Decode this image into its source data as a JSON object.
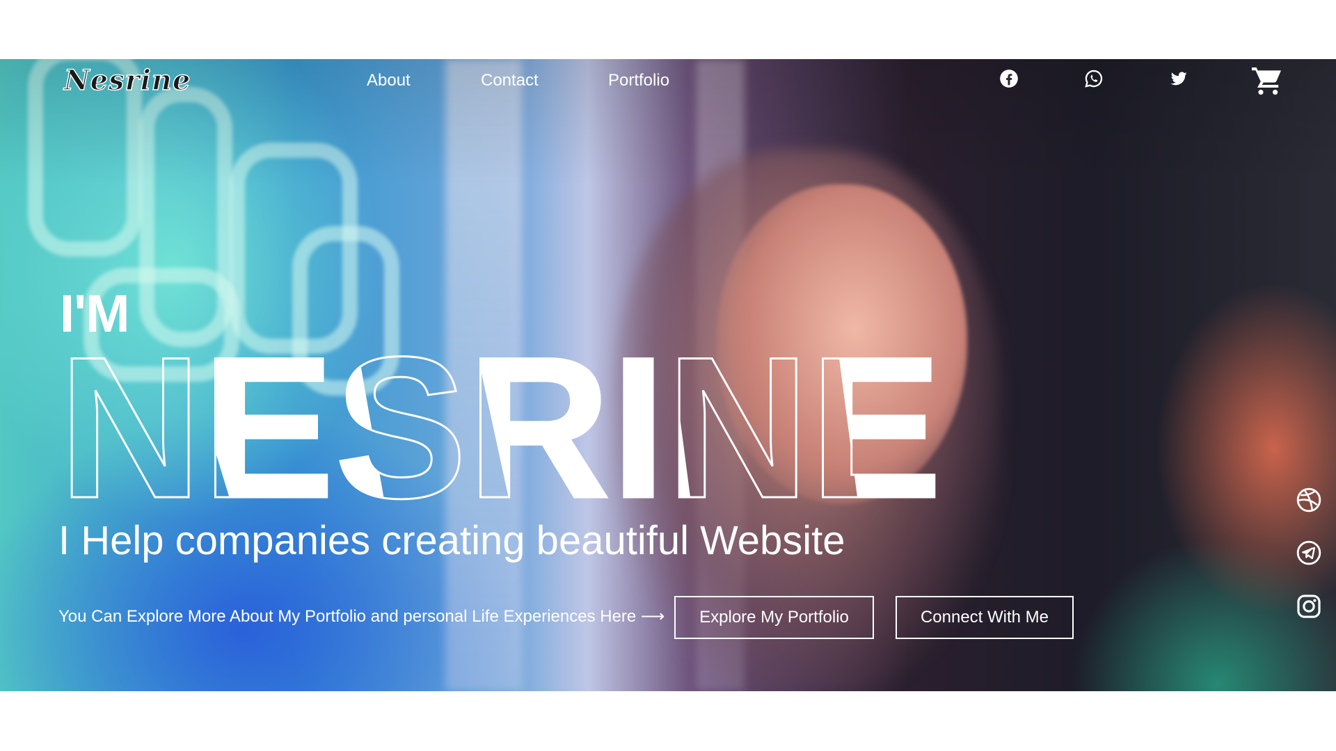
{
  "brand": {
    "logo_text": "Nesrine"
  },
  "nav": {
    "items": [
      {
        "label": "About"
      },
      {
        "label": "Contact"
      },
      {
        "label": "Portfolio"
      }
    ]
  },
  "social_top": [
    {
      "icon": "facebook-icon"
    },
    {
      "icon": "whatsapp-icon"
    },
    {
      "icon": "twitter-icon"
    },
    {
      "icon": "shopping-cart-icon"
    }
  ],
  "hero": {
    "intro": "I'M",
    "name": "NESRINE",
    "tagline": "I Help companies creating beautiful Website",
    "subline": "You Can Explore More About My Portfolio and personal Life Experiences Here ⟶",
    "buttons": {
      "explore": "Explore My Portfolio",
      "connect": "Connect With Me"
    }
  },
  "social_side": [
    {
      "icon": "dribbble-icon"
    },
    {
      "icon": "telegram-icon"
    },
    {
      "icon": "instagram-icon"
    }
  ],
  "colors": {
    "text": "#ffffff",
    "background": "#ffffff",
    "logo": "#1a1a1a"
  }
}
